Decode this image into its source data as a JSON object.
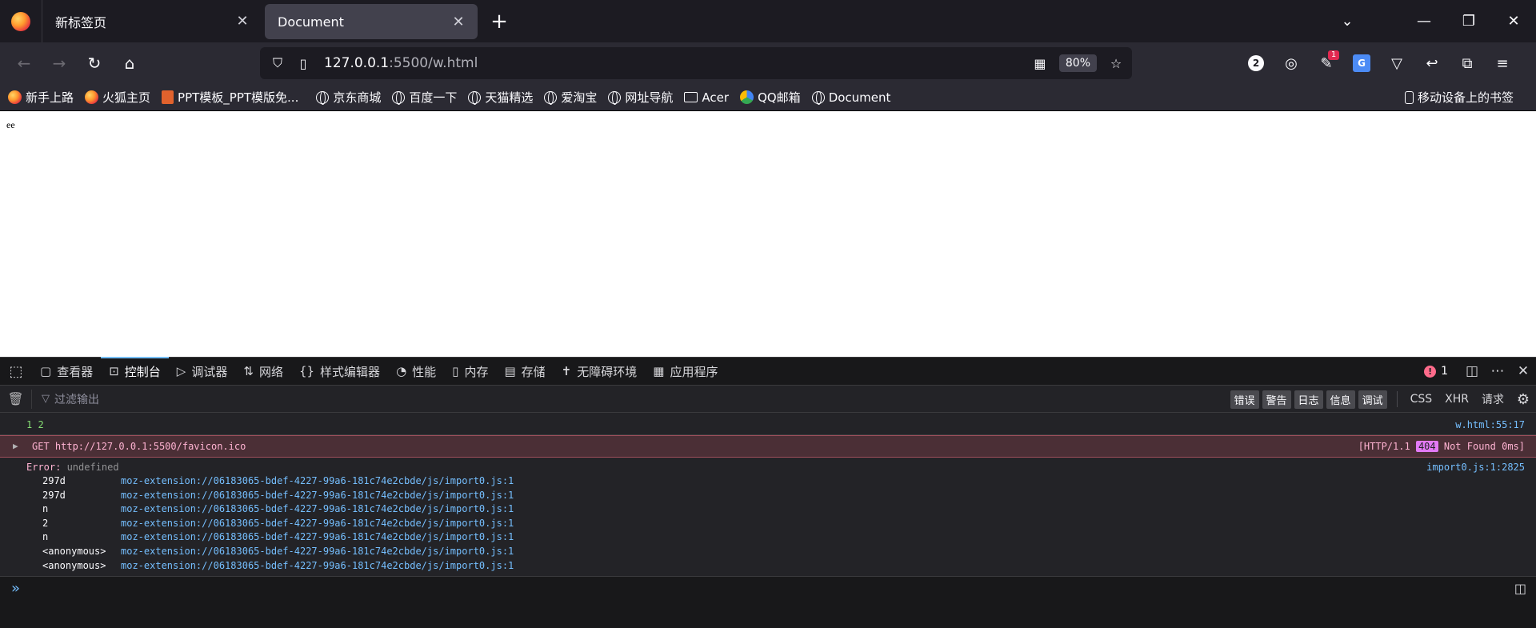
{
  "tabs": [
    {
      "label": "新标签页",
      "active": false
    },
    {
      "label": "Document",
      "active": true
    }
  ],
  "navbar": {
    "url_host": "127.0.0.1",
    "url_rest": ":5500/w.html",
    "zoom": "80%",
    "ext_badge_1": "2",
    "ext_badge_2": "1"
  },
  "bookmarks": [
    {
      "label": "新手上路",
      "icon": "firefox-icon"
    },
    {
      "label": "火狐主页",
      "icon": "firefox-icon"
    },
    {
      "label": "PPT模板_PPT模版免...",
      "icon": "ppt-icon"
    },
    {
      "label": "京东商城",
      "icon": "globe-icon"
    },
    {
      "label": "百度一下",
      "icon": "globe-icon"
    },
    {
      "label": "天猫精选",
      "icon": "globe-icon"
    },
    {
      "label": "爱淘宝",
      "icon": "globe-icon"
    },
    {
      "label": "网址导航",
      "icon": "globe-icon"
    },
    {
      "label": "Acer",
      "icon": "folder-icon"
    },
    {
      "label": "QQ邮箱",
      "icon": "qq-icon"
    },
    {
      "label": "Document",
      "icon": "globe-icon"
    }
  ],
  "mobile_bookmarks": "移动设备上的书签",
  "page": {
    "text": "ee"
  },
  "devtools": {
    "tabs": [
      {
        "label": "查看器",
        "icon": "□"
      },
      {
        "label": "控制台",
        "icon": "▷"
      },
      {
        "label": "调试器",
        "icon": "▷"
      },
      {
        "label": "网络",
        "icon": "⇅"
      },
      {
        "label": "样式编辑器",
        "icon": "{}"
      },
      {
        "label": "性能",
        "icon": "◔"
      },
      {
        "label": "内存",
        "icon": "▯"
      },
      {
        "label": "存储",
        "icon": "▤"
      },
      {
        "label": "无障碍环境",
        "icon": "♿"
      },
      {
        "label": "应用程序",
        "icon": "▦"
      }
    ],
    "error_count": "1",
    "filter_placeholder": "过滤输出",
    "levels": [
      "错误",
      "警告",
      "日志",
      "信息",
      "调试"
    ],
    "types": [
      "CSS",
      "XHR",
      "请求"
    ],
    "log": {
      "line1_text": "1 2",
      "line1_loc": "w.html:55:17",
      "get_text": "GET http://127.0.0.1:5500/favicon.ico",
      "get_status_pre": "[HTTP/1.1 ",
      "get_status_code": "404",
      "get_status_post": " Not Found 0ms]",
      "error_label": "Error: ",
      "error_value": "undefined",
      "error_loc": "import0.js:1:2825",
      "stack": [
        {
          "fn": "297d",
          "src": "moz-extension://06183065-bdef-4227-99a6-181c74e2cbde/js/import0.js:1"
        },
        {
          "fn": "297d",
          "src": "moz-extension://06183065-bdef-4227-99a6-181c74e2cbde/js/import0.js:1"
        },
        {
          "fn": "n",
          "src": "moz-extension://06183065-bdef-4227-99a6-181c74e2cbde/js/import0.js:1"
        },
        {
          "fn": "2",
          "src": "moz-extension://06183065-bdef-4227-99a6-181c74e2cbde/js/import0.js:1"
        },
        {
          "fn": "n",
          "src": "moz-extension://06183065-bdef-4227-99a6-181c74e2cbde/js/import0.js:1"
        },
        {
          "fn": "<anonymous>",
          "src": "moz-extension://06183065-bdef-4227-99a6-181c74e2cbde/js/import0.js:1"
        },
        {
          "fn": "<anonymous>",
          "src": "moz-extension://06183065-bdef-4227-99a6-181c74e2cbde/js/import0.js:1"
        }
      ]
    }
  }
}
